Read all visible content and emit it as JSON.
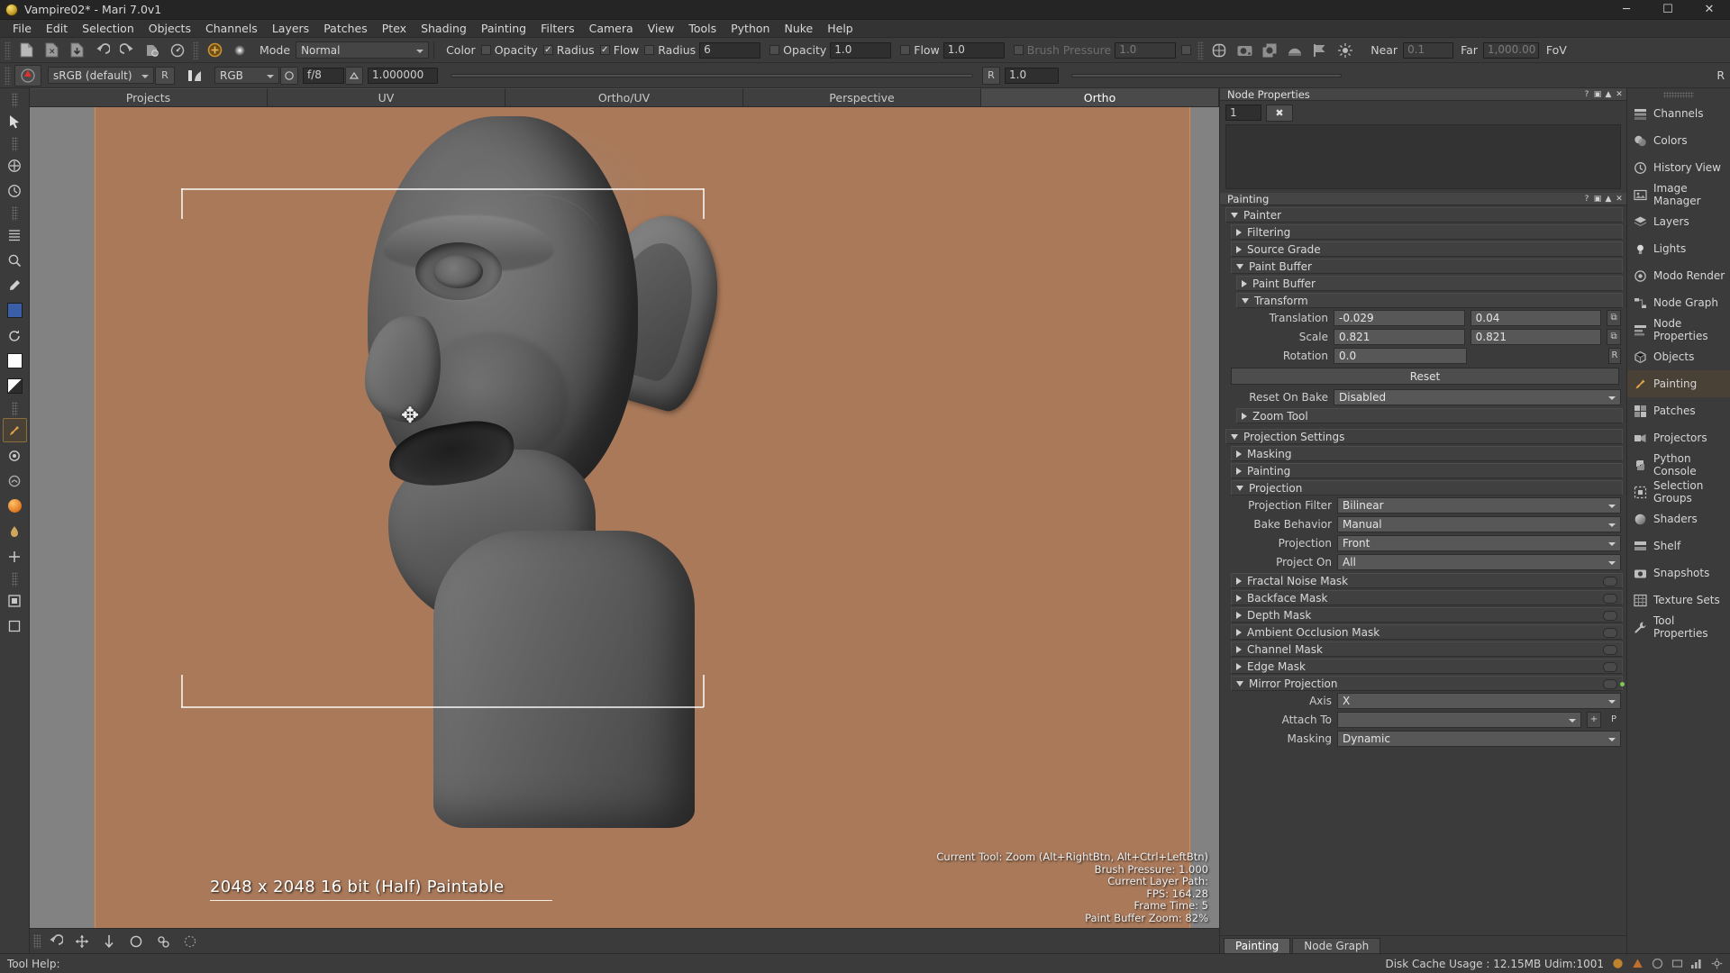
{
  "window": {
    "title": "Vampire02* - Mari 7.0v1",
    "minimize": "─",
    "maximize": "☐",
    "close": "✕"
  },
  "menu": [
    {
      "label": "File"
    },
    {
      "label": "Edit"
    },
    {
      "label": "Selection"
    },
    {
      "label": "Objects"
    },
    {
      "label": "Channels"
    },
    {
      "label": "Layers"
    },
    {
      "label": "Patches"
    },
    {
      "label": "Ptex"
    },
    {
      "label": "Shading"
    },
    {
      "label": "Painting"
    },
    {
      "label": "Filters"
    },
    {
      "label": "Camera"
    },
    {
      "label": "View"
    },
    {
      "label": "Tools"
    },
    {
      "label": "Python"
    },
    {
      "label": "Nuke"
    },
    {
      "label": "Help"
    }
  ],
  "toolbar1": {
    "mode_label": "Mode",
    "mode_value": "Normal",
    "color_label": "Color",
    "opacity_check_label": "Opacity",
    "radius_check_label": "Radius",
    "flow_check_label": "Flow",
    "radius_label": "Radius",
    "radius_value": "6",
    "opacity_label": "Opacity",
    "opacity_value": "1.0",
    "flow_label": "Flow",
    "flow_value": "1.0",
    "brush_pressure_label": "Brush Pressure",
    "brush_pressure_value": "1.0",
    "near_label": "Near",
    "near_value": "0.1",
    "far_label": "Far",
    "far_value": "1,000.00",
    "fov_label": "FoV",
    "checks": {
      "opacity": false,
      "radius": true,
      "flow": true,
      "radius2": false,
      "opacity2": false,
      "flow2": false,
      "pressure": false
    }
  },
  "toolbar2": {
    "colorspace_value": "sRGB (default)",
    "r_button": "R",
    "channel_value": "RGB",
    "fstop_value": "f/8",
    "gamma_value": "1.000000",
    "r_label": "R",
    "r_value": "1.0",
    "r_right": "R"
  },
  "viewport_tabs": [
    {
      "label": "Projects",
      "active": false
    },
    {
      "label": "UV",
      "active": false
    },
    {
      "label": "Ortho/UV",
      "active": false
    },
    {
      "label": "Perspective",
      "active": false
    },
    {
      "label": "Ortho",
      "active": true
    }
  ],
  "viewport": {
    "resolution_text": "2048 x 2048 16 bit (Half) Paintable",
    "stats": [
      "Current Tool: Zoom (Alt+RightBtn, Alt+Ctrl+LeftBtn)",
      "Brush Pressure: 1.000",
      "Current Layer Path:",
      "FPS: 164.28",
      "Frame Time: 5",
      "Paint Buffer Zoom: 82%"
    ]
  },
  "node_properties": {
    "title": "Node Properties",
    "index_value": "1",
    "pin_icon": "✖"
  },
  "painting_panel": {
    "title": "Painting",
    "sections": {
      "painter": "Painter",
      "filtering": "Filtering",
      "source_grade": "Source Grade",
      "paint_buffer_group": "Paint Buffer",
      "paint_buffer_sub": "Paint Buffer",
      "transform": "Transform",
      "zoom_tool": "Zoom Tool",
      "projection_settings": "Projection Settings",
      "masking": "Masking",
      "painting": "Painting",
      "projection": "Projection",
      "fractal_noise_mask": "Fractal Noise Mask",
      "backface_mask": "Backface Mask",
      "depth_mask": "Depth Mask",
      "ambient_occlusion_mask": "Ambient Occlusion Mask",
      "channel_mask": "Channel Mask",
      "edge_mask": "Edge Mask",
      "mirror_projection": "Mirror Projection"
    },
    "transform": {
      "translation_label": "Translation",
      "translation_x": "-0.029",
      "translation_y": "0.04",
      "scale_label": "Scale",
      "scale_x": "0.821",
      "scale_y": "0.821",
      "rotation_label": "Rotation",
      "rotation_value": "0.0",
      "rotation_reset": "R",
      "reset_button": "Reset",
      "reset_on_bake_label": "Reset On Bake",
      "reset_on_bake_value": "Disabled"
    },
    "projection": {
      "filter_label": "Projection Filter",
      "filter_value": "Bilinear",
      "bake_behavior_label": "Bake Behavior",
      "bake_behavior_value": "Manual",
      "projection_label": "Projection",
      "projection_value": "Front",
      "project_on_label": "Project On",
      "project_on_value": "All"
    },
    "mirror": {
      "axis_label": "Axis",
      "axis_value": "X",
      "attach_to_label": "Attach To",
      "attach_to_value": "",
      "attach_add": "+",
      "attach_pick": "P",
      "masking_label": "Masking",
      "masking_value": "Dynamic"
    },
    "tabs": [
      {
        "label": "Painting",
        "active": true
      },
      {
        "label": "Node Graph",
        "active": false
      }
    ]
  },
  "right_sidebar": [
    {
      "label": "Channels",
      "icon": "channels-icon"
    },
    {
      "label": "Colors",
      "icon": "colors-icon"
    },
    {
      "label": "History View",
      "icon": "history-icon"
    },
    {
      "label": "Image Manager",
      "icon": "image-icon"
    },
    {
      "label": "Layers",
      "icon": "layers-icon"
    },
    {
      "label": "Lights",
      "icon": "light-icon"
    },
    {
      "label": "Modo Render",
      "icon": "render-icon"
    },
    {
      "label": "Node Graph",
      "icon": "node-graph-icon"
    },
    {
      "label": "Node Properties",
      "icon": "node-properties-icon"
    },
    {
      "label": "Objects",
      "icon": "objects-icon"
    },
    {
      "label": "Painting",
      "icon": "painting-icon"
    },
    {
      "label": "Patches",
      "icon": "patches-icon"
    },
    {
      "label": "Projectors",
      "icon": "projectors-icon"
    },
    {
      "label": "Python Console",
      "icon": "python-icon"
    },
    {
      "label": "Selection Groups",
      "icon": "selection-groups-icon"
    },
    {
      "label": "Shaders",
      "icon": "shaders-icon"
    },
    {
      "label": "Shelf",
      "icon": "shelf-icon"
    },
    {
      "label": "Snapshots",
      "icon": "snapshots-icon"
    },
    {
      "label": "Texture Sets",
      "icon": "texture-sets-icon"
    },
    {
      "label": "Tool Properties",
      "icon": "tool-properties-icon"
    }
  ],
  "statusbar": {
    "tool_help_label": "Tool Help:",
    "disk_cache": "Disk Cache Usage : 12.15MB Udim:1001"
  },
  "colors": {
    "accent_orange": "#d98b4a",
    "panel_bg": "#3b3b3b",
    "viewport_bg": "#a9795a",
    "viewport_pad": "#828282",
    "active_tab": "#4a4a4a",
    "status_green": "#7ec850"
  }
}
